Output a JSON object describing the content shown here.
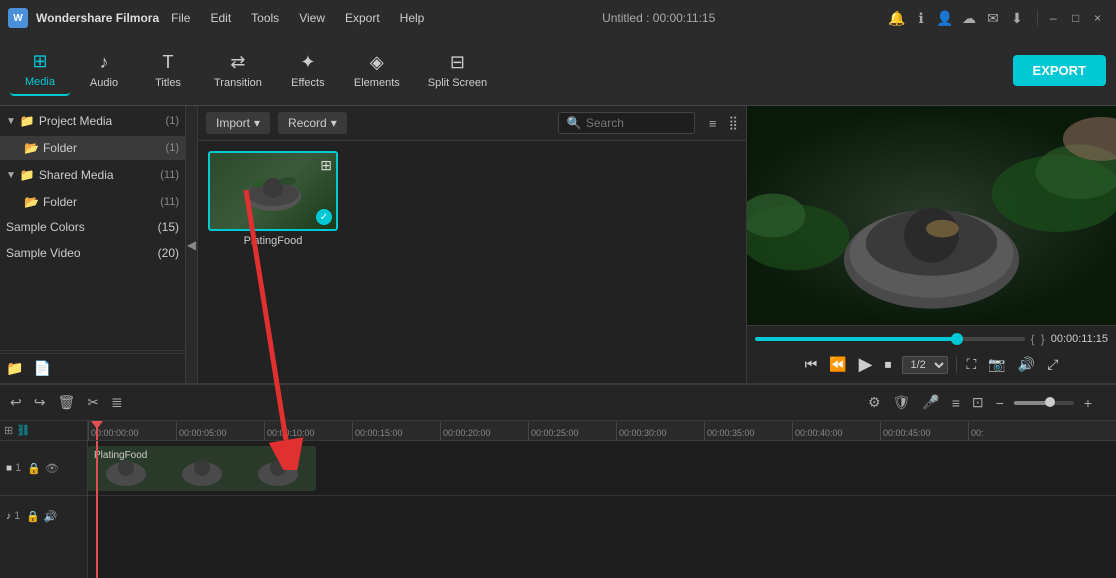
{
  "app": {
    "name": "Wondershare Filmora",
    "logo": "W",
    "title": "Untitled : 00:00:11:15"
  },
  "menu": {
    "items": [
      "File",
      "Edit",
      "Tools",
      "View",
      "Export",
      "Help"
    ]
  },
  "toolbar": {
    "items": [
      {
        "id": "media",
        "label": "Media",
        "icon": "⊞",
        "active": true
      },
      {
        "id": "audio",
        "label": "Audio",
        "icon": "♪"
      },
      {
        "id": "titles",
        "label": "Titles",
        "icon": "T"
      },
      {
        "id": "transition",
        "label": "Transition",
        "icon": "⇄"
      },
      {
        "id": "effects",
        "label": "Effects",
        "icon": "✦"
      },
      {
        "id": "elements",
        "label": "Elements",
        "icon": "◈"
      },
      {
        "id": "splitscreen",
        "label": "Split Screen",
        "icon": "⊟"
      }
    ],
    "export_label": "EXPORT"
  },
  "left_panel": {
    "project_media": {
      "title": "Project Media",
      "count": "(1)"
    },
    "project_folder": {
      "title": "Folder",
      "count": "(1)"
    },
    "shared_media": {
      "title": "Shared Media",
      "count": "(11)"
    },
    "shared_folder": {
      "title": "Folder",
      "count": "(11)"
    },
    "sample_colors": {
      "title": "Sample Colors",
      "count": "(15)"
    },
    "sample_video": {
      "title": "Sample Video",
      "count": "(20)"
    }
  },
  "center_panel": {
    "import_label": "Import",
    "record_label": "Record",
    "search_placeholder": "Search",
    "media_items": [
      {
        "id": "platingfood",
        "label": "PlatingFood",
        "selected": true
      }
    ]
  },
  "preview": {
    "time": "00:00:11:15",
    "speed": "1/2",
    "progress_pct": 75
  },
  "timeline": {
    "undo_label": "undo",
    "redo_label": "redo",
    "clip_label": "PlatingFood",
    "ruler_marks": [
      "00:00:00:00",
      "00:00:05:00",
      "00:00:10:00",
      "00:00:15:00",
      "00:00:20:00",
      "00:00:25:00",
      "00:00:30:00",
      "00:00:35:00",
      "00:00:40:00",
      "00:00:45:00",
      "00:"
    ],
    "track1_num": "1",
    "track2_num": "1"
  },
  "window_controls": {
    "minimize": "–",
    "maximize": "□",
    "close": "×"
  }
}
